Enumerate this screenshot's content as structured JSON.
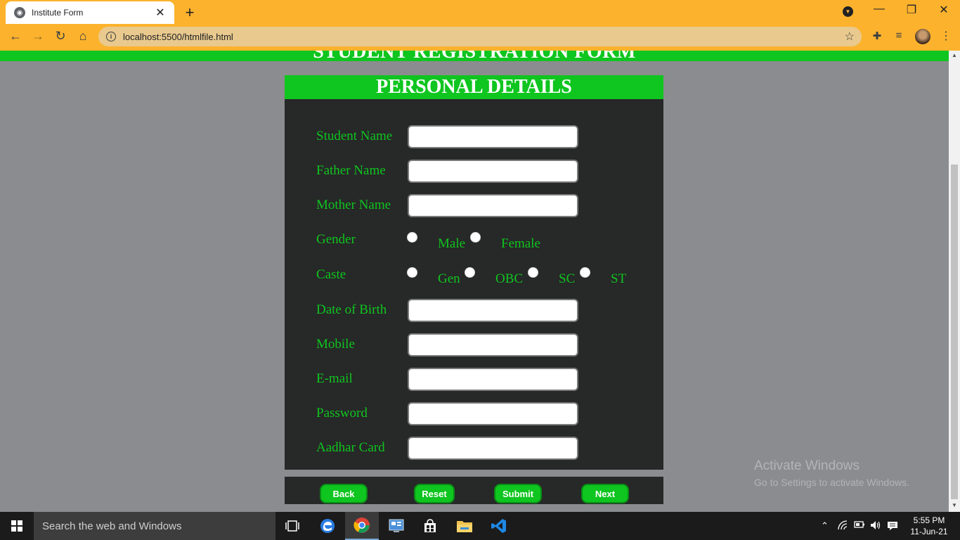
{
  "browser": {
    "tab_title": "Institute Form",
    "url": "localhost:5500/htmlfile.html"
  },
  "page": {
    "banner_title": "STUDENT REGISTRATION FORM",
    "section_title": "PERSONAL DETAILS",
    "fields": {
      "student_name": {
        "label": "Student Name",
        "value": ""
      },
      "father_name": {
        "label": "Father Name",
        "value": ""
      },
      "mother_name": {
        "label": "Mother Name",
        "value": ""
      },
      "date_of_birth": {
        "label": "Date of Birth",
        "value": ""
      },
      "mobile": {
        "label": "Mobile",
        "value": ""
      },
      "email": {
        "label": "E-mail",
        "value": ""
      },
      "password": {
        "label": "Password",
        "value": ""
      },
      "aadhar": {
        "label": "Aadhar Card",
        "value": ""
      }
    },
    "gender": {
      "label": "Gender",
      "options": [
        "Male",
        "Female"
      ],
      "selected": null
    },
    "caste": {
      "label": "Caste",
      "options": [
        "Gen",
        "OBC",
        "SC",
        "ST"
      ],
      "selected": null
    },
    "buttons": {
      "back": "Back",
      "reset": "Reset",
      "submit": "Submit",
      "next": "Next"
    },
    "colors": {
      "accent": "#0fc51f",
      "panel": "#272828",
      "background": "#8b8c8f"
    }
  },
  "watermark": {
    "line1": "Activate Windows",
    "line2": "Go to Settings to activate Windows."
  },
  "taskbar": {
    "search_placeholder": "Search the web and Windows",
    "time": "5:55 PM",
    "date": "11-Jun-21"
  }
}
